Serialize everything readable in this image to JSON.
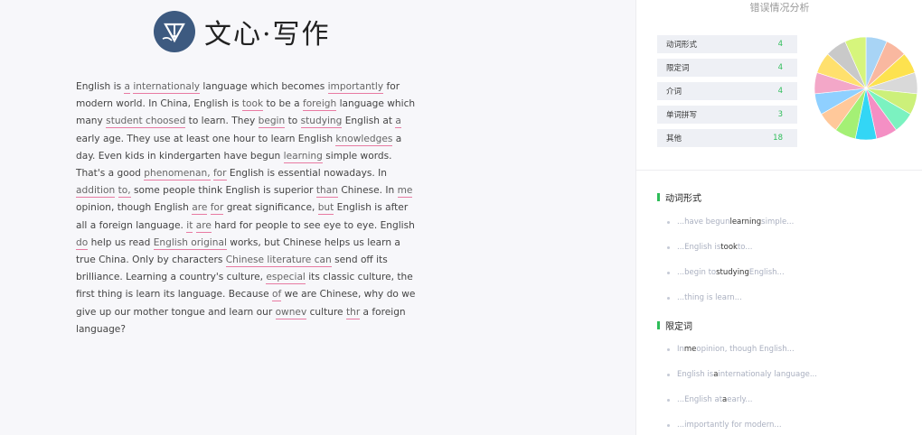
{
  "app": {
    "logo_text": "文心·写作"
  },
  "essay": {
    "segments": [
      {
        "t": "English is "
      },
      {
        "t": "a",
        "e": true
      },
      {
        "t": " "
      },
      {
        "t": "internationaly",
        "e": true
      },
      {
        "t": " language which becomes "
      },
      {
        "t": "importantly",
        "e": true
      },
      {
        "t": " for modern world. In China, English is "
      },
      {
        "t": "took",
        "e": true
      },
      {
        "t": " to be a "
      },
      {
        "t": "foreigh",
        "e": true
      },
      {
        "t": " language which many "
      },
      {
        "t": "student choosed",
        "e": true
      },
      {
        "t": " to learn. They "
      },
      {
        "t": "begin",
        "e": true
      },
      {
        "t": " to "
      },
      {
        "t": "studying",
        "e": true
      },
      {
        "t": " English at "
      },
      {
        "t": "a",
        "e": true
      },
      {
        "t": " early age. They use at least one hour to learn English "
      },
      {
        "t": "knowledges",
        "e": true
      },
      {
        "t": " a day. Even kids in kindergarten have begun "
      },
      {
        "t": "learning",
        "e": true
      },
      {
        "t": " simple words. That's a good "
      },
      {
        "t": "phenomenan,",
        "e": true
      },
      {
        "t": " "
      },
      {
        "t": "for",
        "e": true
      },
      {
        "t": " English is essential nowadays. In "
      },
      {
        "t": "addition",
        "e": true
      },
      {
        "t": " "
      },
      {
        "t": "to,",
        "e": true
      },
      {
        "t": " some people think English is superior "
      },
      {
        "t": "than",
        "e": true
      },
      {
        "t": " Chinese. In "
      },
      {
        "t": "me",
        "e": true
      },
      {
        "t": " opinion, though English "
      },
      {
        "t": "are",
        "e": true
      },
      {
        "t": " "
      },
      {
        "t": "for",
        "e": true
      },
      {
        "t": " great significance, "
      },
      {
        "t": "but",
        "e": true
      },
      {
        "t": " English is after all a foreign language. "
      },
      {
        "t": "it",
        "e": true
      },
      {
        "t": " "
      },
      {
        "t": "are",
        "e": true
      },
      {
        "t": " hard for people to see eye to eye. English "
      },
      {
        "t": "do",
        "e": true
      },
      {
        "t": " help us read "
      },
      {
        "t": "English original",
        "e": true
      },
      {
        "t": " works, but Chinese helps us learn a true China. Only by characters "
      },
      {
        "t": "Chinese literature can",
        "e": true
      },
      {
        "t": " send off its brilliance. Learning a country's culture, "
      },
      {
        "t": "especial",
        "e": true
      },
      {
        "t": " its classic culture, the first thing is learn its language. Because "
      },
      {
        "t": "of",
        "e": true
      },
      {
        "t": " we are Chinese, why do we give up our mother tongue and learn our "
      },
      {
        "t": "ownev",
        "e": true
      },
      {
        "t": " culture "
      },
      {
        "t": "thr",
        "e": true
      },
      {
        "t": " a foreign language?"
      }
    ]
  },
  "panel": {
    "title": "错误情况分析",
    "stats": [
      {
        "label": "动词形式",
        "count": "4"
      },
      {
        "label": "限定词",
        "count": "4"
      },
      {
        "label": "介词",
        "count": "4"
      },
      {
        "label": "单词拼写",
        "count": "3"
      },
      {
        "label": "其他",
        "count": "18"
      }
    ],
    "pie_colors": [
      "#a8d4f5",
      "#f9b8a0",
      "#fde24f",
      "#d9d9d9",
      "#ccf07a",
      "#7bf2c0",
      "#f48fc4",
      "#33d6f5",
      "#a4f075",
      "#ffc89a",
      "#8fd0ff",
      "#f3a7c8",
      "#ffe06d",
      "#c9c9c9",
      "#d6f57c"
    ],
    "sections": [
      {
        "title": "动词形式",
        "items": [
          {
            "pre": "...have begun ",
            "hl": "learning",
            "post": " simple..."
          },
          {
            "pre": "...English is ",
            "hl": "took",
            "post": " to..."
          },
          {
            "pre": "...begin to ",
            "hl": "studying",
            "post": " English..."
          },
          {
            "pre": "...thing is learn...",
            "hl": "",
            "post": ""
          }
        ]
      },
      {
        "title": "限定词",
        "items": [
          {
            "pre": "In ",
            "hl": "me",
            "post": " opinion, though English..."
          },
          {
            "pre": "English is ",
            "hl": "a",
            "post": " internationaly language..."
          },
          {
            "pre": "...English at ",
            "hl": "a",
            "post": " early..."
          },
          {
            "pre": "...importantly for modern...",
            "hl": "",
            "post": ""
          }
        ]
      }
    ]
  }
}
